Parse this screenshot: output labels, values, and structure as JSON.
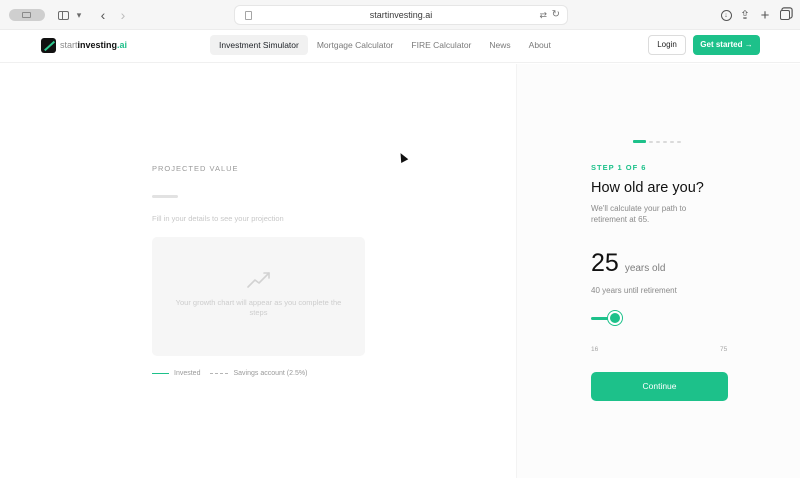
{
  "browser": {
    "url": "startinvesting.ai"
  },
  "header": {
    "logo": {
      "pre": "start",
      "mid": "investing",
      "suf": ".ai"
    },
    "nav": [
      {
        "label": "Investment Simulator"
      },
      {
        "label": "Mortgage Calculator"
      },
      {
        "label": "FIRE Calculator"
      },
      {
        "label": "News"
      },
      {
        "label": "About"
      }
    ],
    "login_label": "Login",
    "get_started_label": "Get started →"
  },
  "projection": {
    "label": "PROJECTED VALUE",
    "hint": "Fill in your details to see your projection",
    "chart_message": "Your growth chart will appear as you complete the steps",
    "legend": {
      "invested": "Invested",
      "savings": "Savings account (2.5%)"
    }
  },
  "wizard": {
    "progress": {
      "current": 1,
      "total": 6
    },
    "step_label": "STEP 1 OF 6",
    "question": "How old are you?",
    "subtext": "We'll calculate your path to retirement at 65.",
    "age_value": "25",
    "age_unit": "years old",
    "years_until": "40 years until retirement",
    "slider": {
      "value": 25,
      "min_label": "16",
      "max_label": "75"
    },
    "continue_label": "Continue"
  },
  "colors": {
    "accent": "#1dc18a"
  }
}
